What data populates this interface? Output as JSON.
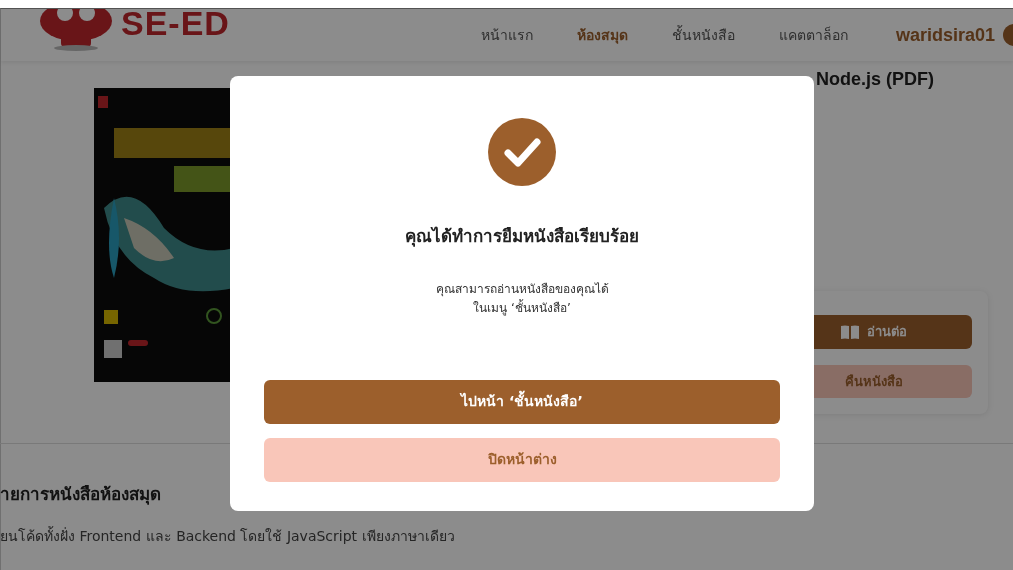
{
  "navbar": {
    "logo": "SE-ED",
    "links": [
      {
        "label": "หน้าแรก",
        "selected": false
      },
      {
        "label": "ห้องสมุด",
        "selected": true
      },
      {
        "label": "ชั้นหนังสือ",
        "selected": false
      },
      {
        "label": "แคตตาล็อก",
        "selected": false
      }
    ],
    "user": "waridsira01"
  },
  "book": {
    "title": "Node.js (PDF)",
    "buttons": [
      {
        "label": "อ่านต่อ",
        "kind": "primary"
      },
      {
        "label": "คืนหนังสือ",
        "kind": "secondary"
      }
    ]
  },
  "section": {
    "heading": "ายการหนังสือห้องสมุด",
    "description": "ยนโค้ดทั้งฝั่ง Frontend และ Backend โดยใช้ JavaScript เพียงภาษาเดียว"
  },
  "modal": {
    "title": "คุณได้ทำการยืมหนังสือเรียบร้อย",
    "message": [
      "คุณสามารถอ่านหนังสือของคุณได้",
      "ในเมนู ‘ชั้นหนังสือ’"
    ],
    "buttons": [
      {
        "label": "ไปหน้า ‘ชั้นหนังสือ’",
        "kind": "primary"
      },
      {
        "label": "ปิดหน้าต่าง",
        "kind": "secondary"
      }
    ]
  }
}
